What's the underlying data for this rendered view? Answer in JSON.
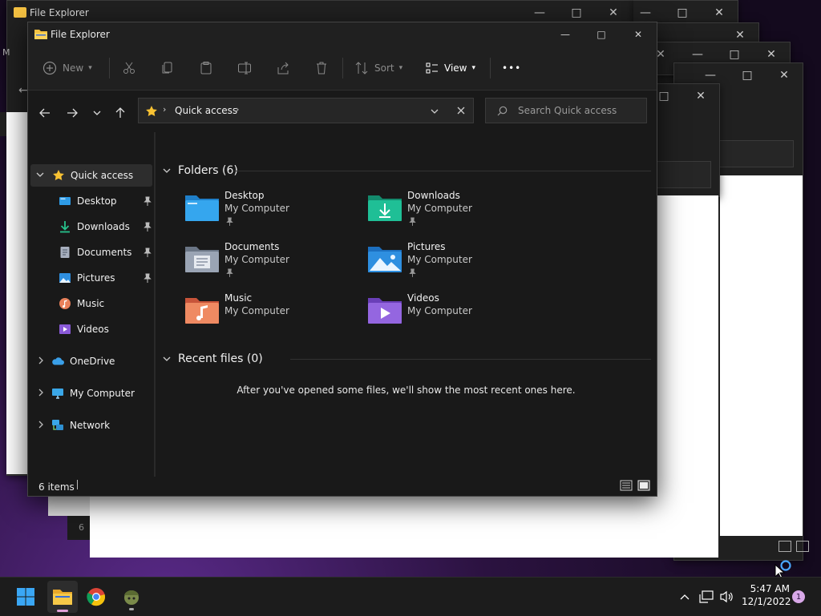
{
  "background_windows": {
    "title": "File Explorer",
    "truncated_label_1": "M",
    "truncated_label_2": "6"
  },
  "window": {
    "title": "File Explorer",
    "controls": {
      "minimize": "—",
      "maximize": "□",
      "close": "✕"
    }
  },
  "toolbar": {
    "new_label": "New",
    "sort_label": "Sort",
    "view_label": "View",
    "more_label": "•••"
  },
  "nav": {
    "address_label": "Quick access",
    "search_placeholder": "Search Quick access"
  },
  "sidebar": {
    "items": [
      {
        "label": "Quick access",
        "icon": "star-icon",
        "selected": true
      },
      {
        "label": "Desktop",
        "icon": "desktop-icon",
        "pinned": true
      },
      {
        "label": "Downloads",
        "icon": "download-icon",
        "pinned": true
      },
      {
        "label": "Documents",
        "icon": "document-icon",
        "pinned": true
      },
      {
        "label": "Pictures",
        "icon": "pictures-icon",
        "pinned": true
      },
      {
        "label": "Music",
        "icon": "music-icon"
      },
      {
        "label": "Videos",
        "icon": "videos-icon"
      },
      {
        "label": "OneDrive",
        "icon": "cloud-icon"
      },
      {
        "label": "My Computer",
        "icon": "computer-icon"
      },
      {
        "label": "Network",
        "icon": "network-icon"
      }
    ]
  },
  "content": {
    "folders_header": "Folders (6)",
    "folders": [
      {
        "name": "Desktop",
        "location": "My Computer",
        "pinned": true,
        "color": "#2e9be6"
      },
      {
        "name": "Downloads",
        "location": "My Computer",
        "pinned": true,
        "color": "#1fae8a"
      },
      {
        "name": "Documents",
        "location": "My Computer",
        "pinned": true,
        "color": "#8a96a8"
      },
      {
        "name": "Pictures",
        "location": "My Computer",
        "pinned": true,
        "color": "#2e8fe0"
      },
      {
        "name": "Music",
        "location": "My Computer",
        "pinned": false,
        "color": "#e8805a"
      },
      {
        "name": "Videos",
        "location": "My Computer",
        "pinned": false,
        "color": "#8a5ad8"
      }
    ],
    "recent_header": "Recent files (0)",
    "recent_empty": "After you've opened some files, we'll show the most recent ones here."
  },
  "status": {
    "items": "6 items"
  },
  "taskbar": {
    "time": "5:47 AM",
    "date": "12/1/2022",
    "notification_count": "1"
  },
  "colors": {
    "accent": "#4aa8ff",
    "folder_yellow": "#f5c242",
    "star": "#f8c233"
  }
}
